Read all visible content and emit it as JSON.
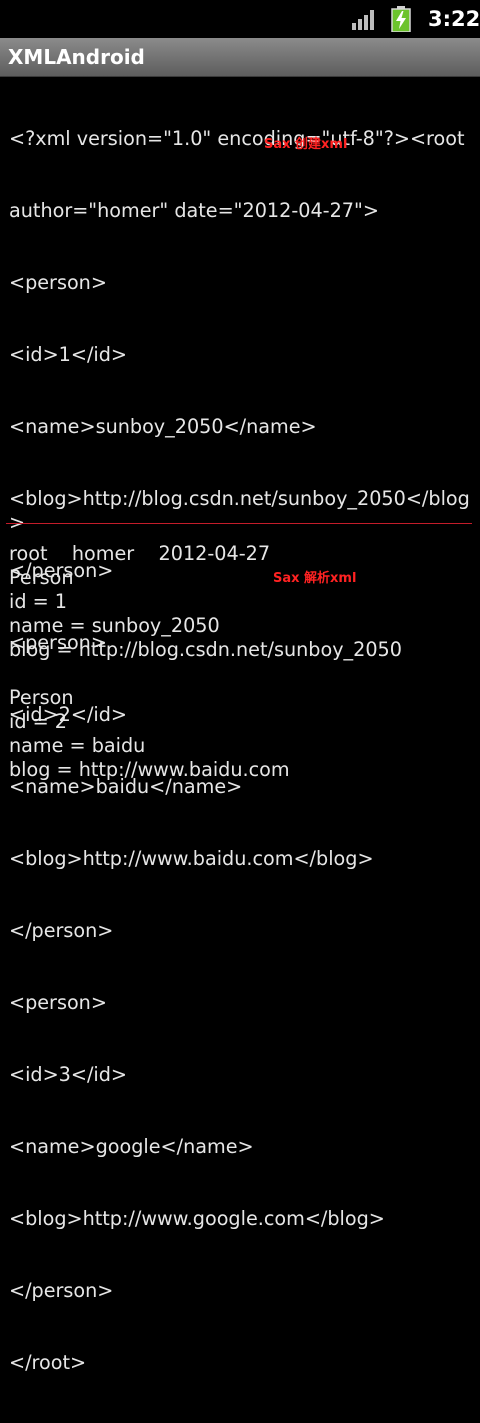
{
  "status_bar": {
    "time": "3:22",
    "signal_icon": "signal-bars-icon",
    "battery_icon": "battery-charging-icon",
    "battery_color": "#6cc32c"
  },
  "app": {
    "title": "XMLAndroid"
  },
  "annotations": {
    "create_note": "Sax 创建xml",
    "parse_note": "Sax 解析xml",
    "note_color": "#ff2222"
  },
  "xml_output": [
    "<?xml version=\"1.0\" encoding=\"utf-8\"?><root",
    "author=\"homer\" date=\"2012-04-27\">",
    "<person>",
    "<id>1</id>",
    "<name>sunboy_2050</name>",
    "<blog>http://blog.csdn.net/sunboy_2050</blog>",
    "</person>",
    "<person>",
    "<id>2</id>",
    "<name>baidu</name>",
    "<blog>http://www.baidu.com</blog>",
    "</person>",
    "<person>",
    "<id>3</id>",
    "<name>google</name>",
    "<blog>http://www.google.com</blog>",
    "</person>",
    "</root>"
  ],
  "divider_color": "#c41c2a",
  "parse_output": [
    "root    homer    2012-04-27",
    "Person",
    "id = 1",
    "name = sunboy_2050",
    "blog = http://blog.csdn.net/sunboy_2050",
    "",
    "Person",
    "id = 2",
    "name = baidu",
    "blog = http://www.baidu.com"
  ]
}
